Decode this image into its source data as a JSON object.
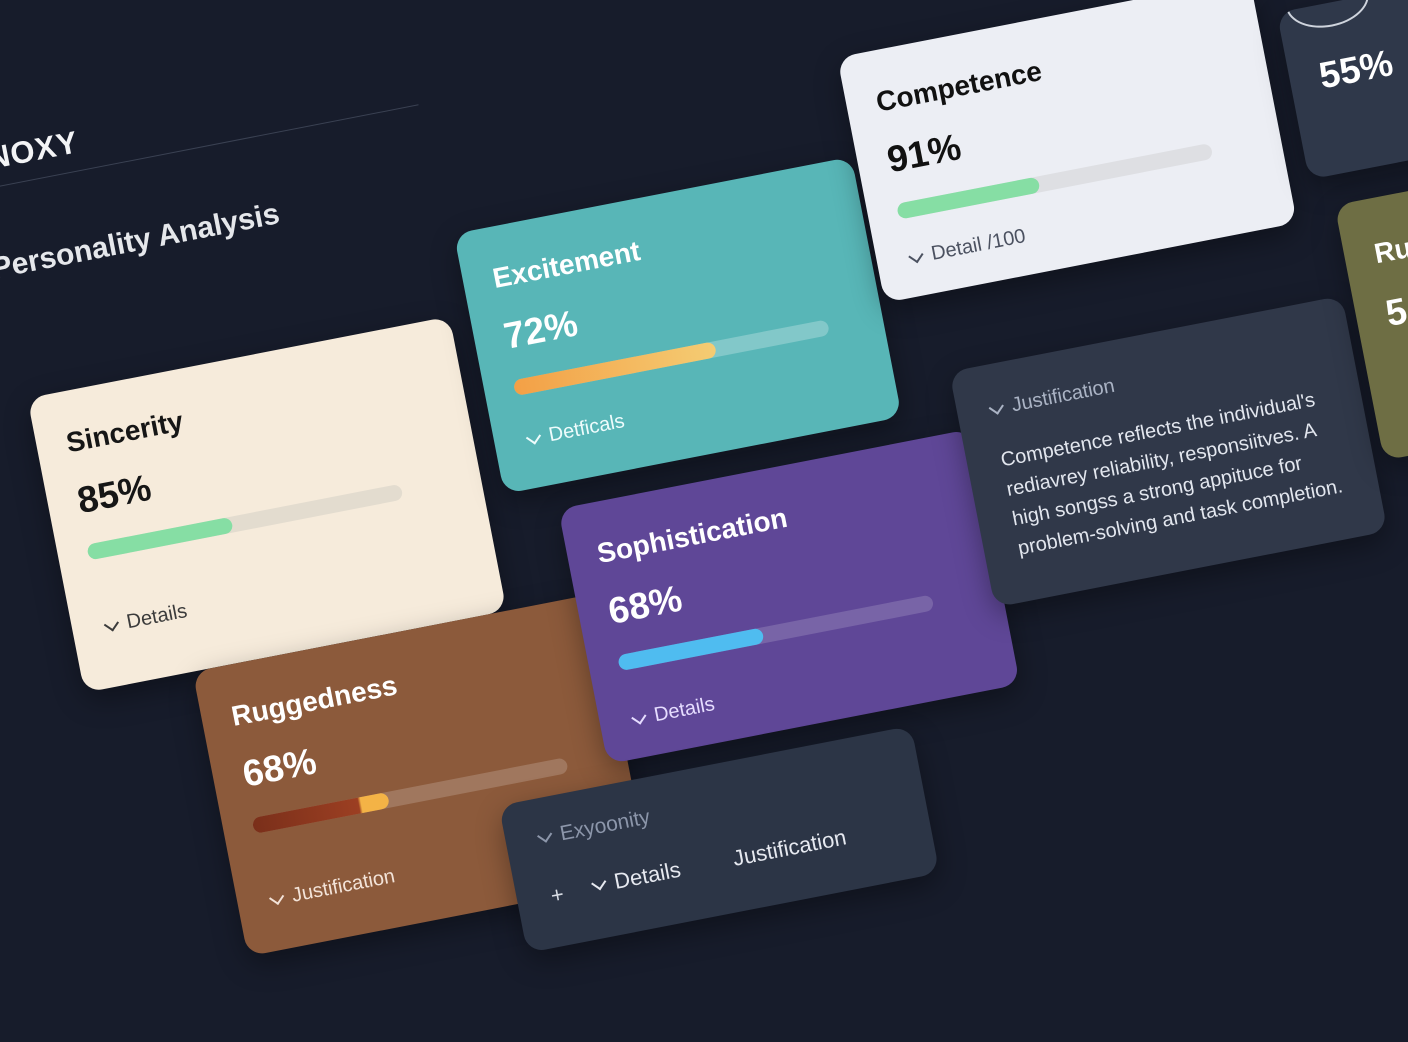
{
  "app": {
    "brand": "ADNOXY"
  },
  "section": {
    "title": "Personality Analysis"
  },
  "cards": {
    "sincerity": {
      "title": "Sincerity",
      "percent": "85%",
      "progress": 0.46,
      "link": "Details"
    },
    "excitement": {
      "title": "Excitement",
      "percent": "72%",
      "progress": 0.64,
      "link": "Detficals"
    },
    "competence": {
      "title": "Competence",
      "percent": "91%",
      "progress": 0.45,
      "link": "Detail /100"
    },
    "ruggedness": {
      "title": "Ruggedness",
      "percent": "68%",
      "progress": 0.43,
      "link": "Justification"
    },
    "sophistication": {
      "title": "Sophistication",
      "percent": "68%",
      "progress": 0.46,
      "link": "Details"
    }
  },
  "justification_panel": {
    "title": "Justification",
    "body": "Competence reflects the individual's rediavrey reliability, responsiitves. A high songss a strong appituce for problem-solving and task completion."
  },
  "extra_panel": {
    "title": "Exyoonity",
    "add_symbol": "+",
    "details_label": "Details",
    "justification_label": "Justification"
  },
  "right_partial": {
    "top_percent": "55%",
    "bottom_title": "Ru",
    "bottom_percent": "5"
  },
  "colors": {
    "background": "#171c2b",
    "sincerity": "#f6ebdb",
    "excitement": "#58b6b7",
    "competence": "#eceef4",
    "ruggedness": "#8c5a3b",
    "sophistication": "#5f4797",
    "panel": "#303849"
  }
}
